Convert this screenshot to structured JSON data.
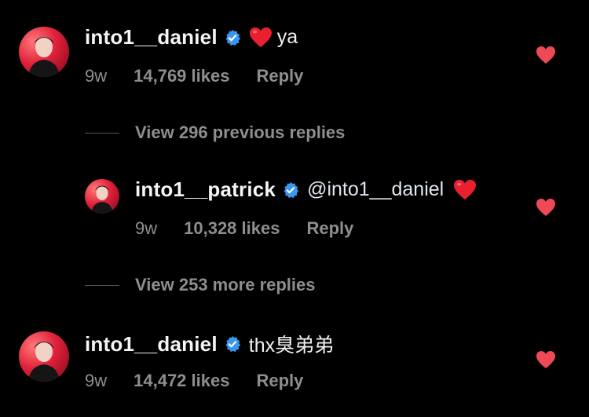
{
  "comments": [
    {
      "username": "into1__daniel",
      "text": "ya",
      "time": "9w",
      "likes": "14,769 likes",
      "reply_label": "Reply"
    },
    {
      "username": "into1__patrick",
      "mention": "@into1__daniel",
      "time": "9w",
      "likes": "10,328 likes",
      "reply_label": "Reply"
    },
    {
      "username": "into1__daniel",
      "text": "thx臭弟弟",
      "time": "9w",
      "likes": "14,472 likes",
      "reply_label": "Reply"
    }
  ],
  "view_previous": "View 296 previous replies",
  "view_more": "View 253 more replies",
  "icons": {
    "verified": "verified-badge-icon",
    "heart_emoji": "red-heart-emoji",
    "like": "heart-like-icon"
  },
  "colors": {
    "background": "#000000",
    "verified": "#3897f0",
    "heart": "#ed4956",
    "secondary_text": "#8e8e8e"
  }
}
